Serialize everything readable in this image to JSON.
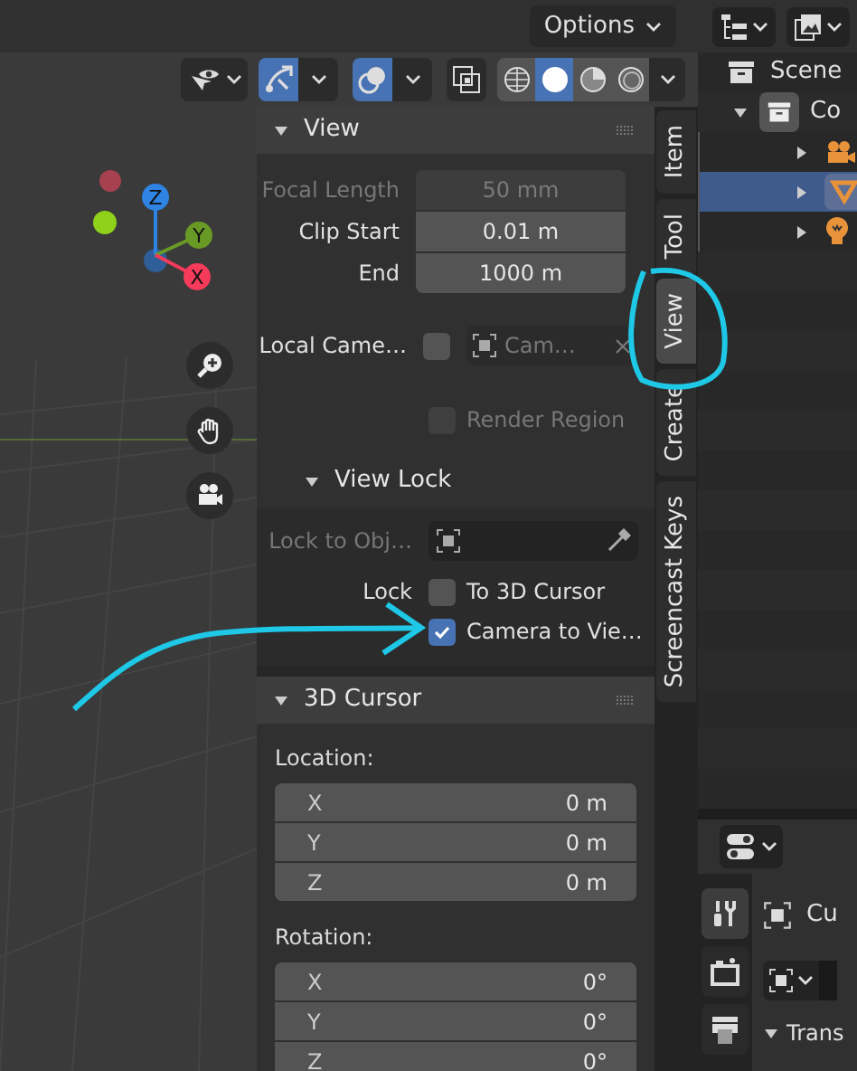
{
  "header": {
    "options_button": "Options"
  },
  "viewport_toolbar": {
    "gizmos_on": true,
    "overlays_on": true,
    "xray_on": false,
    "shading_modes": [
      {
        "kind": "wireframe",
        "selected": false
      },
      {
        "kind": "solid",
        "selected": true
      },
      {
        "kind": "material",
        "selected": false
      },
      {
        "kind": "rendered",
        "selected": false
      }
    ]
  },
  "gizmo": {
    "axes": [
      {
        "label": "Z",
        "color": "#2f83e3"
      },
      {
        "label": "Y",
        "color": "#6a9a26"
      },
      {
        "label": "X",
        "color": "#f53a5a"
      }
    ]
  },
  "sidebar_tabs": [
    {
      "label": "Item",
      "selected": false
    },
    {
      "label": "Tool",
      "selected": false
    },
    {
      "label": "View",
      "selected": true
    },
    {
      "label": "Create",
      "selected": false
    },
    {
      "label": "Screencast Keys",
      "selected": false
    }
  ],
  "view_panel": {
    "title": "View",
    "expanded": true,
    "fields": [
      {
        "label": "Focal Length",
        "value": "50 mm",
        "disabled": true
      },
      {
        "label": "Clip Start",
        "value": "0.01 m",
        "disabled": false
      },
      {
        "label": "End",
        "value": "1000 m",
        "disabled": false
      }
    ],
    "local_camera": {
      "label": "Local Came…",
      "checked": false,
      "placeholder": "Cam…"
    },
    "render_region": {
      "label": "Render Region",
      "checked": false,
      "disabled": true
    },
    "view_lock": {
      "title": "View Lock",
      "expanded": true,
      "lock_to_object_label": "Lock to Obj…",
      "lock_label": "Lock",
      "options": [
        {
          "label": "To 3D Cursor",
          "checked": false
        },
        {
          "label": "Camera to Vie…",
          "checked": true
        }
      ]
    }
  },
  "cursor_panel": {
    "title": "3D Cursor",
    "expanded": true,
    "location_label": "Location:",
    "location": [
      {
        "axis": "X",
        "value": "0 m"
      },
      {
        "axis": "Y",
        "value": "0 m"
      },
      {
        "axis": "Z",
        "value": "0 m"
      }
    ],
    "rotation_label": "Rotation:",
    "rotation": [
      {
        "axis": "X",
        "value": "0°"
      },
      {
        "axis": "Y",
        "value": "0°"
      },
      {
        "axis": "Z",
        "value": "0°"
      }
    ]
  },
  "outliner": {
    "items": [
      {
        "kind": "scene",
        "label": "Scene",
        "children": [
          {
            "kind": "collection",
            "label": "Co",
            "expanded": true,
            "children": [
              {
                "kind": "camera",
                "expanded": false,
                "selected": false
              },
              {
                "kind": "mesh",
                "expanded": false,
                "selected": true
              },
              {
                "kind": "light",
                "expanded": false,
                "selected": false
              }
            ]
          }
        ]
      }
    ]
  },
  "properties": {
    "tabs": [
      {
        "kind": "tool",
        "selected": true
      },
      {
        "kind": "render",
        "selected": false
      },
      {
        "kind": "output",
        "selected": false
      }
    ],
    "object_label": "Cu",
    "section_title": "Trans",
    "section_expanded": true
  }
}
